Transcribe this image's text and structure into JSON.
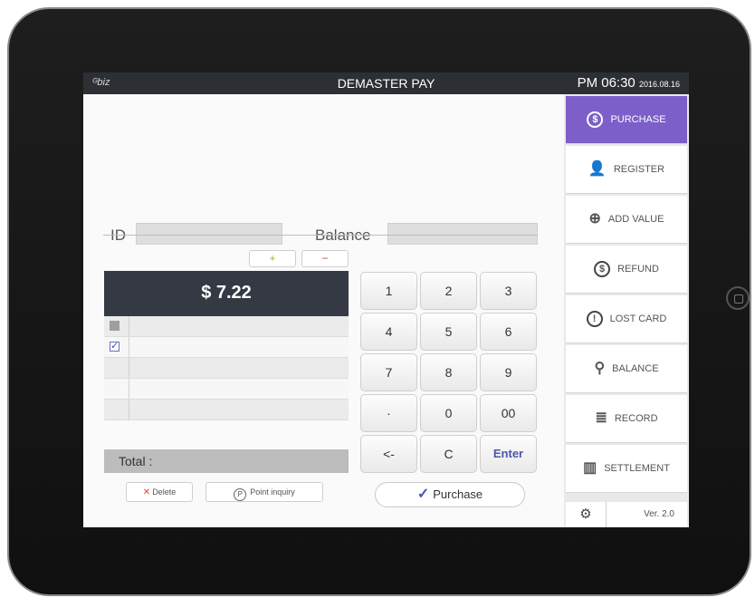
{
  "topbar": {
    "logo": "ᴳbiz",
    "title": "DEMASTER PAY",
    "time": "PM 06:30",
    "date": "2016.08.16"
  },
  "form": {
    "id_label": "ID",
    "balance_label": "Balance"
  },
  "cart": {
    "plus": "+",
    "minus": "−",
    "amount": "$ 7.22",
    "total_label": "Total :",
    "rows": [
      {
        "checked": false
      },
      {
        "checked": true
      },
      {
        "checked": null
      },
      {
        "checked": null
      },
      {
        "checked": null
      }
    ],
    "delete_x": "✕",
    "delete_label": "Delete",
    "point_icon": "P",
    "point_label": "Point inquiry"
  },
  "keypad": {
    "keys": [
      "1",
      "2",
      "3",
      "4",
      "5",
      "6",
      "7",
      "8",
      "9",
      "·",
      "0",
      "00",
      "<-",
      "C",
      "Enter"
    ],
    "purchase_check": "✓",
    "purchase_label": "Purchase"
  },
  "sidebar": {
    "active_color": "#7c5fc8",
    "items": [
      {
        "label": "PURCHASE",
        "icon": "$",
        "icon_name": "dollar-circle-icon"
      },
      {
        "label": "REGISTER",
        "icon": "👤",
        "icon_name": "user-icon"
      },
      {
        "label": "ADD VALUE",
        "icon": "⊕",
        "icon_name": "coins-add-icon"
      },
      {
        "label": "REFUND",
        "icon": "$",
        "icon_name": "refund-icon"
      },
      {
        "label": "LOST CARD",
        "icon": "!",
        "icon_name": "alert-icon"
      },
      {
        "label": "BALANCE",
        "icon": "⚲",
        "icon_name": "search-icon"
      },
      {
        "label": "RECORD",
        "icon": "≣",
        "icon_name": "clipboard-icon"
      },
      {
        "label": "SETTLEMENT",
        "icon": "▥",
        "icon_name": "chart-icon"
      }
    ],
    "gear_icon": "⚙",
    "version": "Ver. 2.0"
  }
}
